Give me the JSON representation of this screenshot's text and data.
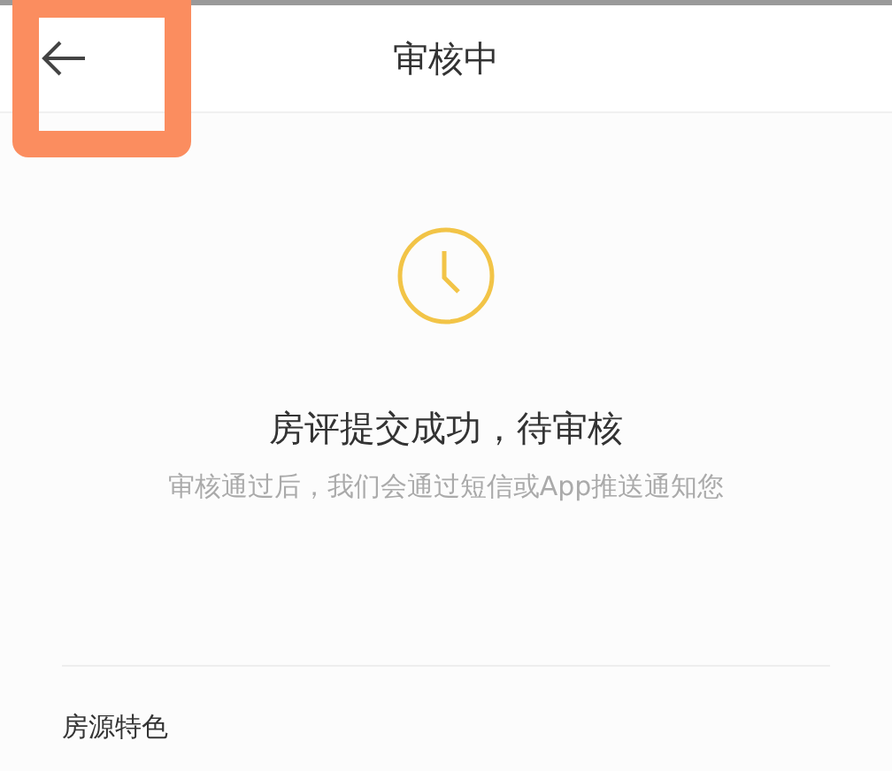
{
  "header": {
    "title": "审核中",
    "back_highlighted": true
  },
  "status": {
    "title": "房评提交成功，待审核",
    "message": "审核通过后，我们会通过短信或App推送通知您"
  },
  "section": {
    "title": "房源特色"
  }
}
